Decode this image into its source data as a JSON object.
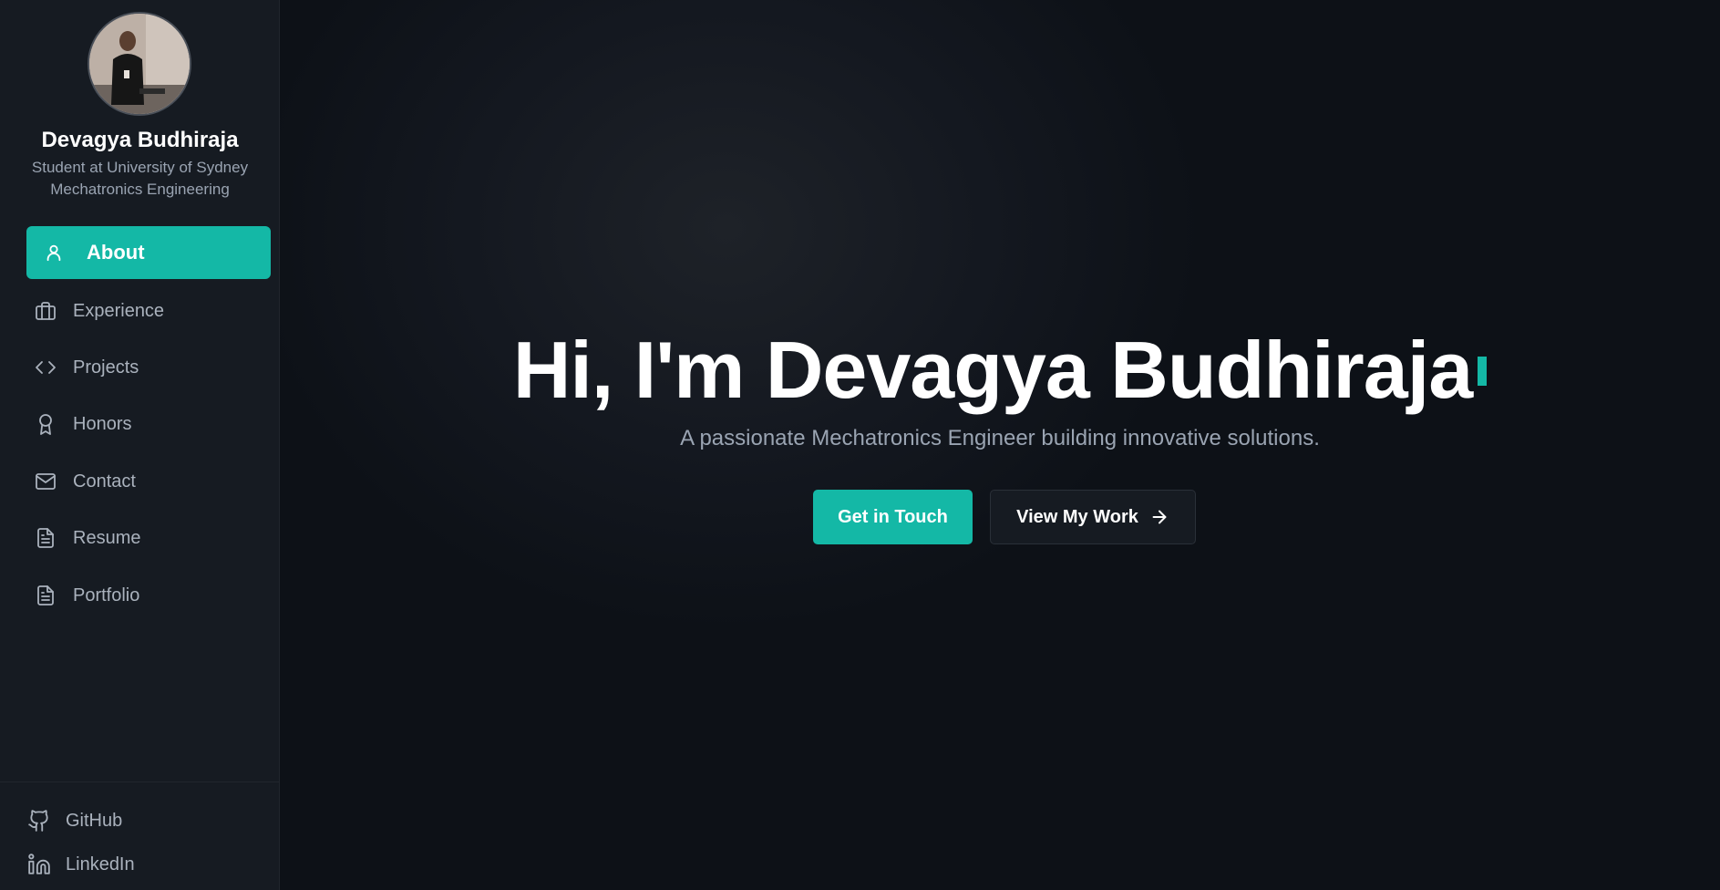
{
  "profile": {
    "name": "Devagya Budhiraja",
    "subtitle_line1": "Student at University of Sydney",
    "subtitle_line2": "Mechatronics Engineering",
    "avatar_icon": "profile-photo"
  },
  "nav": {
    "items": [
      {
        "label": "About",
        "icon": "user-icon",
        "active": true
      },
      {
        "label": "Experience",
        "icon": "briefcase-icon",
        "active": false
      },
      {
        "label": "Projects",
        "icon": "code-icon",
        "active": false
      },
      {
        "label": "Honors",
        "icon": "award-icon",
        "active": false
      },
      {
        "label": "Contact",
        "icon": "mail-icon",
        "active": false
      },
      {
        "label": "Resume",
        "icon": "document-icon",
        "active": false
      },
      {
        "label": "Portfolio",
        "icon": "document-icon",
        "active": false
      }
    ]
  },
  "social": {
    "github": "GitHub",
    "linkedin": "LinkedIn"
  },
  "hero": {
    "title": "Hi, I'm Devagya Budhiraja",
    "subtitle": "A passionate Mechatronics Engineer building innovative solutions.",
    "primary_button": "Get in Touch",
    "secondary_button": "View My Work"
  },
  "colors": {
    "accent": "#14b8a6",
    "sidebar_bg": "#161b22",
    "page_bg": "#0d1117",
    "text_muted": "#9aa4b2"
  }
}
